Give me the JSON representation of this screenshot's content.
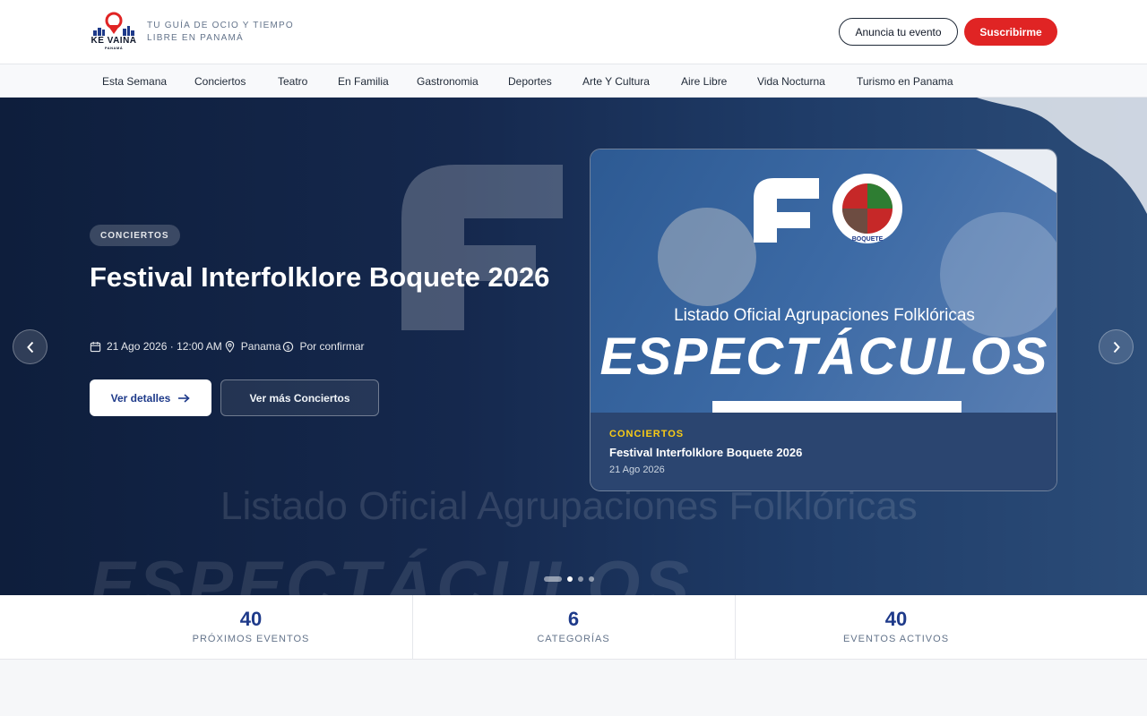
{
  "header": {
    "logo_word": "KE VAINA",
    "logo_sub": "PANAMÁ",
    "tagline": "TU GUÍA DE OCIO Y TIEMPO LIBRE EN PANAMÁ",
    "announce_label": "Anuncia tu evento",
    "subscribe_label": "Suscribirme"
  },
  "nav": {
    "items": [
      {
        "label": "Esta Semana"
      },
      {
        "label": "Conciertos"
      },
      {
        "label": "Teatro"
      },
      {
        "label": "En Familia"
      },
      {
        "label": "Gastronomia"
      },
      {
        "label": "Deportes"
      },
      {
        "label": "Arte Y Cultura"
      },
      {
        "label": "Aire Libre"
      },
      {
        "label": "Vida Nocturna"
      },
      {
        "label": "Turismo en Panama"
      }
    ]
  },
  "hero": {
    "category": "CONCIERTOS",
    "title": "Festival Interfolklore Boquete 2026",
    "date": "21 Ago 2026 · 12:00 AM",
    "location": "Panama",
    "price": "Por confirmar",
    "details_label": "Ver detalles",
    "more_label": "Ver más Conciertos",
    "bg_text_1": "Listado Oficial Agrupaciones Folklóricas",
    "bg_text_2": "ESPECTÁCULOS",
    "active_slide": 1,
    "slide_count": 4
  },
  "card": {
    "image_subtitle": "Listado Oficial Agrupaciones Folklóricas",
    "image_title": "ESPECTÁCULOS",
    "seal_text": "BOQUETE",
    "category": "CONCIERTOS",
    "title": "Festival Interfolklore Boquete 2026",
    "date": "21 Ago 2026"
  },
  "stats": [
    {
      "value": "40",
      "label": "PRÓXIMOS EVENTOS"
    },
    {
      "value": "6",
      "label": "CATEGORÍAS"
    },
    {
      "value": "40",
      "label": "EVENTOS ACTIVOS"
    }
  ],
  "colors": {
    "brand_red": "#e02424",
    "brand_navy": "#1e3a8a",
    "accent_yellow": "#facc15"
  }
}
